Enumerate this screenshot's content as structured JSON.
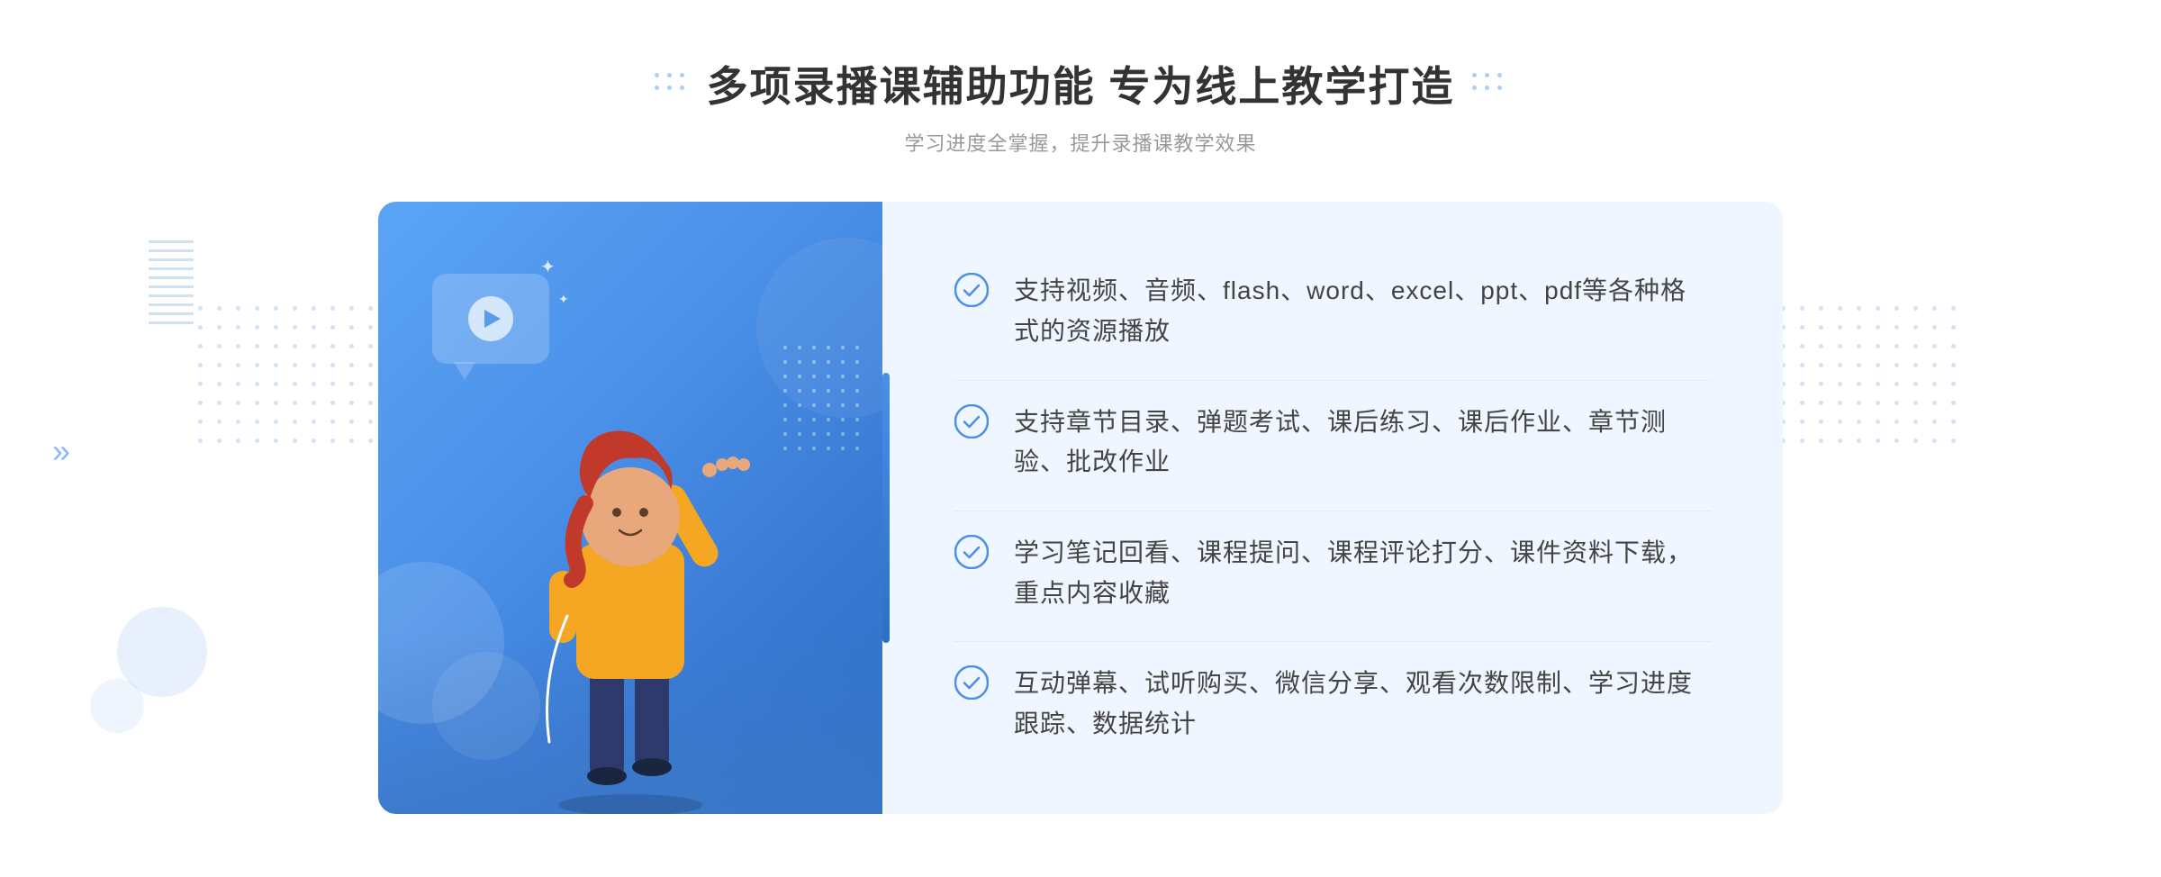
{
  "header": {
    "title": "多项录播课辅助功能 专为线上教学打造",
    "subtitle": "学习进度全掌握，提升录播课教学效果"
  },
  "features": [
    {
      "id": "feature-1",
      "text": "支持视频、音频、flash、word、excel、ppt、pdf等各种格式的资源播放"
    },
    {
      "id": "feature-2",
      "text": "支持章节目录、弹题考试、课后练习、课后作业、章节测验、批改作业"
    },
    {
      "id": "feature-3",
      "text": "学习笔记回看、课程提问、课程评论打分、课件资料下载，重点内容收藏"
    },
    {
      "id": "feature-4",
      "text": "互动弹幕、试听购买、微信分享、观看次数限制、学习进度跟踪、数据统计"
    }
  ],
  "decoration": {
    "chevron_left": "»",
    "chevron_right": "»"
  }
}
